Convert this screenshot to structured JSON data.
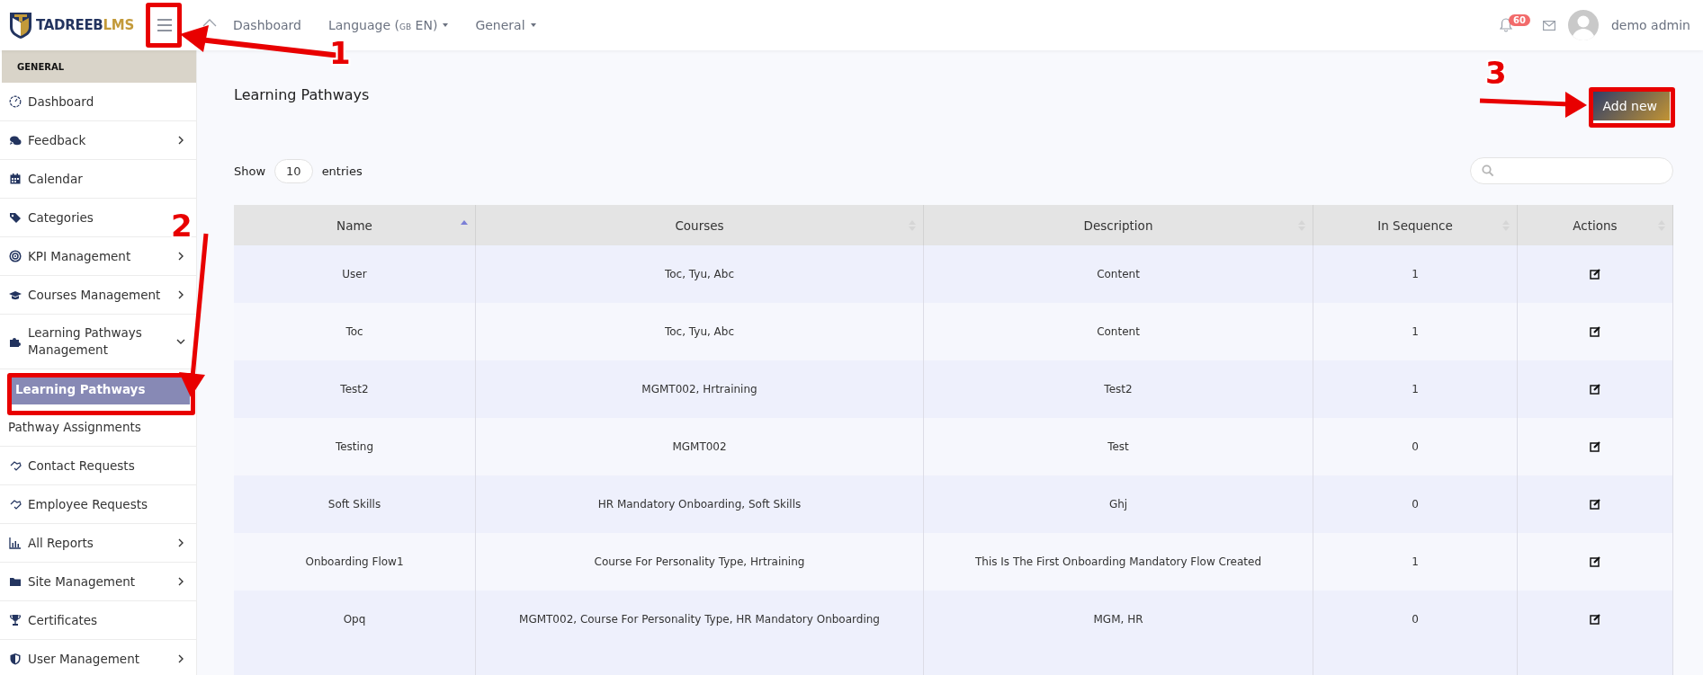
{
  "brand": {
    "name_part_1": "TADREEB",
    "name_part_2": "LMS"
  },
  "topnav": [
    {
      "label": "Dashboard",
      "dropdown": false
    },
    {
      "label": "Language (",
      "small": "GB",
      "after": " EN)",
      "dropdown": true
    },
    {
      "label": "General",
      "dropdown": true
    }
  ],
  "user_area": {
    "notification_count": "60",
    "username": "demo admin"
  },
  "sidebar": {
    "section": "GENERAL",
    "items": [
      {
        "label": "Dashboard",
        "submenu": false
      },
      {
        "label": "Feedback",
        "submenu": true,
        "expanded": false
      },
      {
        "label": "Calendar",
        "submenu": false
      },
      {
        "label": "Categories",
        "submenu": false
      },
      {
        "label": "KPI Management",
        "submenu": true,
        "expanded": false
      },
      {
        "label": "Courses Management",
        "submenu": true,
        "expanded": false
      },
      {
        "label": "Learning Pathways Management",
        "submenu": true,
        "expanded": true,
        "children": [
          {
            "label": "Learning Pathways",
            "selected": true
          },
          {
            "label": "Pathway Assignments",
            "selected": false
          }
        ]
      },
      {
        "label": "Contact Requests",
        "submenu": false
      },
      {
        "label": "Employee Requests",
        "submenu": false
      },
      {
        "label": "All Reports",
        "submenu": true,
        "expanded": false
      },
      {
        "label": "Site Management",
        "submenu": true,
        "expanded": false
      },
      {
        "label": "Certificates",
        "submenu": false
      },
      {
        "label": "User Management",
        "submenu": true,
        "expanded": false
      }
    ]
  },
  "page": {
    "title": "Learning Pathways",
    "add_button": "Add new"
  },
  "table_controls": {
    "show_label": "Show",
    "page_size": "10",
    "entries_label": "entries"
  },
  "table": {
    "columns": [
      {
        "label": "Name",
        "sorted": true
      },
      {
        "label": "Courses",
        "sorted": false
      },
      {
        "label": "Description",
        "sorted": false
      },
      {
        "label": "In Sequence",
        "sorted": false
      },
      {
        "label": "Actions",
        "sorted": false
      }
    ],
    "rows": [
      [
        "User",
        "Toc, Tyu, Abc",
        "Content",
        "1"
      ],
      [
        "Toc",
        "Toc, Tyu, Abc",
        "Content",
        "1"
      ],
      [
        "Test2",
        "MGMT002, Hrtraining",
        "Test2",
        "1"
      ],
      [
        "Testing",
        "MGMT002",
        "Test",
        "0"
      ],
      [
        "Soft Skills",
        "HR Mandatory Onboarding, Soft Skills",
        "Ghj",
        "0"
      ],
      [
        "Onboarding Flow1",
        "Course For Personality Type, Hrtraining",
        "This Is The First Onboarding Mandatory Flow Created",
        "1"
      ],
      [
        "Opq",
        "MGMT002, Course For Personality Type, HR Mandatory Onboarding",
        "MGM, HR",
        "0"
      ]
    ]
  },
  "callouts": [
    {
      "number": "1"
    },
    {
      "number": "2"
    },
    {
      "number": "3"
    }
  ]
}
